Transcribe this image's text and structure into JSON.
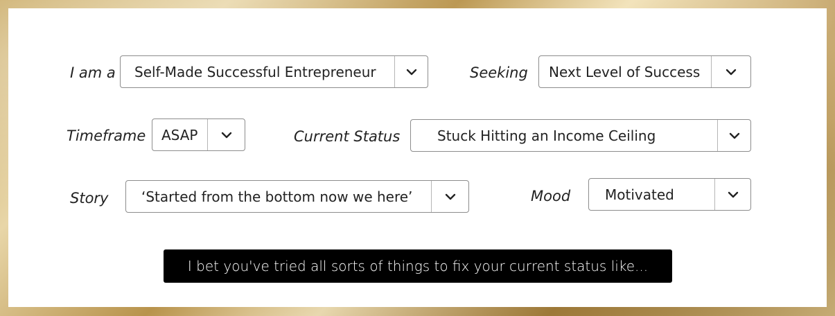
{
  "form": {
    "i_am": {
      "label": "I am a",
      "value": "Self-Made Successful Entrepreneur"
    },
    "seeking": {
      "label": "Seeking",
      "value": "Next Level of Success"
    },
    "timeframe": {
      "label": "Timeframe",
      "value": "ASAP"
    },
    "current_status": {
      "label": "Current Status",
      "value": "Stuck Hitting an Income Ceiling"
    },
    "story": {
      "label": "Story",
      "value": "‘Started from the bottom now we here’"
    },
    "mood": {
      "label": "Mood",
      "value": "Motivated"
    }
  },
  "cta": {
    "text": "I bet you've tried all sorts of things to fix your current status like..."
  },
  "icons": {
    "dropdown": "chevron-down-icon"
  },
  "colors": {
    "frame": "#c9a962",
    "panel": "#ffffff",
    "cta_bg": "#000000",
    "cta_text": "#ffffff"
  }
}
